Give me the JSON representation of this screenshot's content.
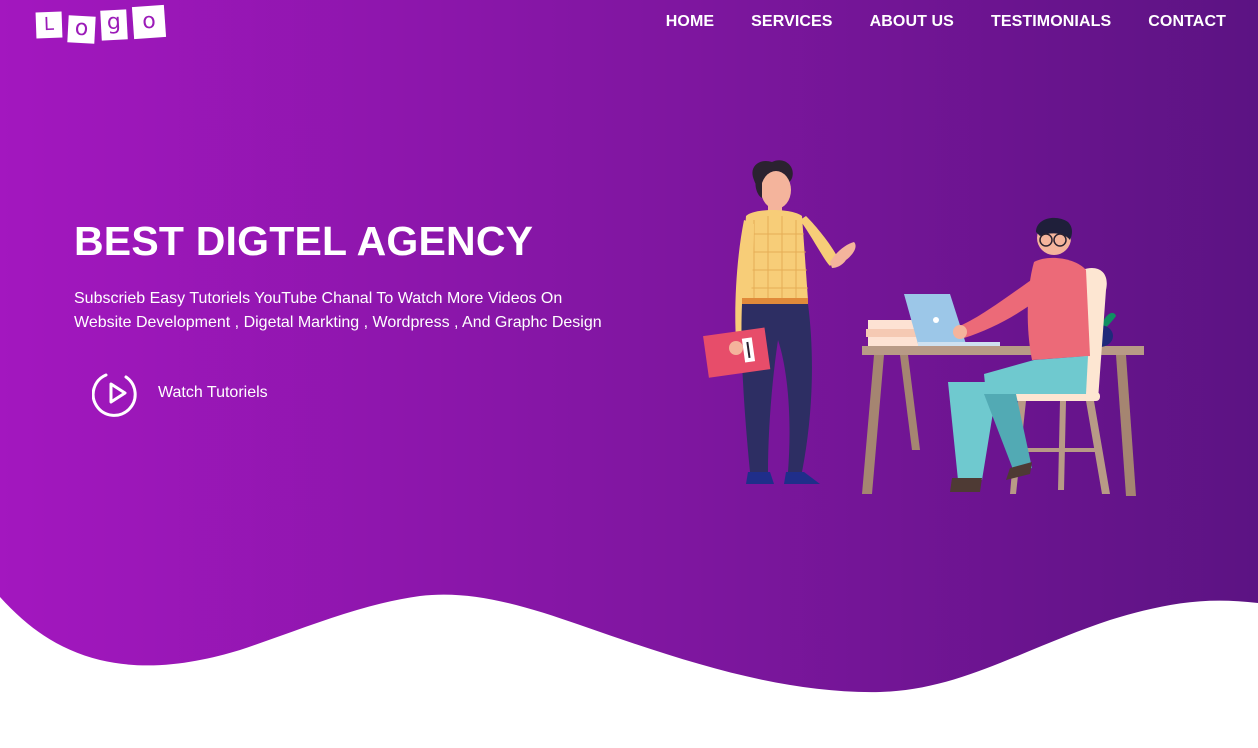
{
  "brand": {
    "logo_letters": [
      "L",
      "o",
      "g",
      "o"
    ]
  },
  "nav": {
    "items": [
      {
        "label": "HOME"
      },
      {
        "label": "SERVICES"
      },
      {
        "label": "ABOUT US"
      },
      {
        "label": "TESTIMONIALS"
      },
      {
        "label": "CONTACT"
      }
    ]
  },
  "hero": {
    "title": "BEST DIGTEL AGENCY",
    "subtitle_line1": "Subscrieb Easy Tutoriels YouTube Chanal To Watch More Videos On",
    "subtitle_line2": "Website Development , Digetal Markting , Wordpress , And Graphc Design",
    "cta_label": "Watch Tutoriels",
    "cta_icon": "play-circle-icon"
  },
  "colors": {
    "gradient_start": "#a016be",
    "gradient_end": "#5a1282",
    "text": "#ffffff",
    "below_wave": "#ffffff"
  }
}
